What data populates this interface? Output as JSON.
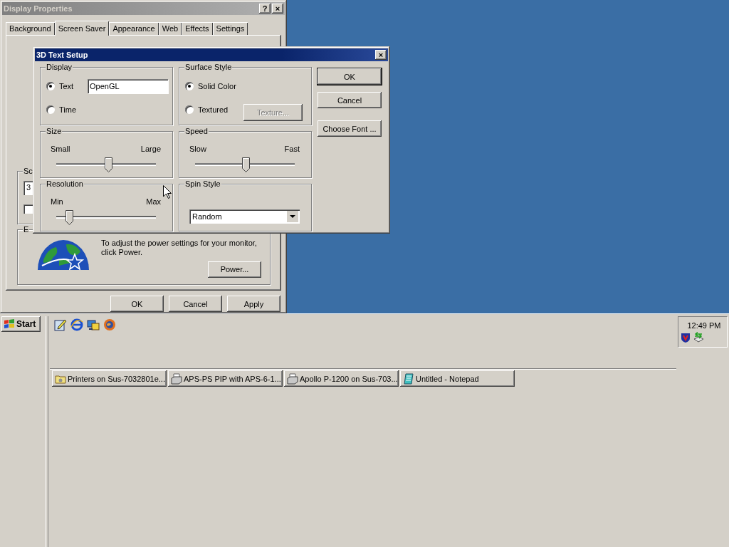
{
  "display_properties": {
    "title": "Display Properties",
    "title_buttons": [
      "?",
      "×"
    ],
    "tabs": [
      {
        "label": "Background",
        "selected": false
      },
      {
        "label": "Screen Saver",
        "selected": true
      },
      {
        "label": "Appearance",
        "selected": false
      },
      {
        "label": "Web",
        "selected": false
      },
      {
        "label": "Effects",
        "selected": false
      },
      {
        "label": "Settings",
        "selected": false
      }
    ],
    "screen_saver_group": {
      "label": "Sc",
      "field_value": "3",
      "checkbox_checked": false
    },
    "energy_group": {
      "label": "E",
      "text": "To adjust the power settings for your monitor, click Power.",
      "button": "Power..."
    },
    "buttons": [
      "OK",
      "Cancel",
      "Apply"
    ]
  },
  "dialog": {
    "title": "3D Text Setup",
    "close": "×",
    "display": {
      "label": "Display",
      "options": [
        {
          "label": "Text",
          "selected": true
        },
        {
          "label": "Time",
          "selected": false
        }
      ],
      "text_value": "OpenGL"
    },
    "surface_style": {
      "label": "Surface Style",
      "options": [
        {
          "label": "Solid Color",
          "selected": true
        },
        {
          "label": "Textured",
          "selected": false
        }
      ],
      "texture_button": {
        "label": "Texture...",
        "disabled": true
      }
    },
    "size": {
      "label": "Size",
      "min_label": "Small",
      "max_label": "Large",
      "level": 0.52
    },
    "speed": {
      "label": "Speed",
      "min_label": "Slow",
      "max_label": "Fast",
      "level": 0.51
    },
    "resolution": {
      "label": "Resolution",
      "min_label": "Min",
      "max_label": "Max",
      "level": 0.13
    },
    "spin_style": {
      "label": "Spin Style",
      "value": "Random"
    },
    "buttons": [
      "OK",
      "Cancel",
      "Choose Font ..."
    ]
  },
  "taskbar": {
    "start": "Start",
    "tasks": [
      {
        "label": "Printers on Sus-7032801e...",
        "kind": "folder",
        "selected": false
      },
      {
        "label": "APS-PS PIP with APS-6-1...",
        "kind": "printer",
        "selected": false
      },
      {
        "label": "Apollo P-1200 on Sus-703...",
        "kind": "printer",
        "selected": false
      },
      {
        "label": "Untitled - Notepad",
        "kind": "notepad",
        "selected": false
      }
    ],
    "clock": "12:49 PM"
  }
}
